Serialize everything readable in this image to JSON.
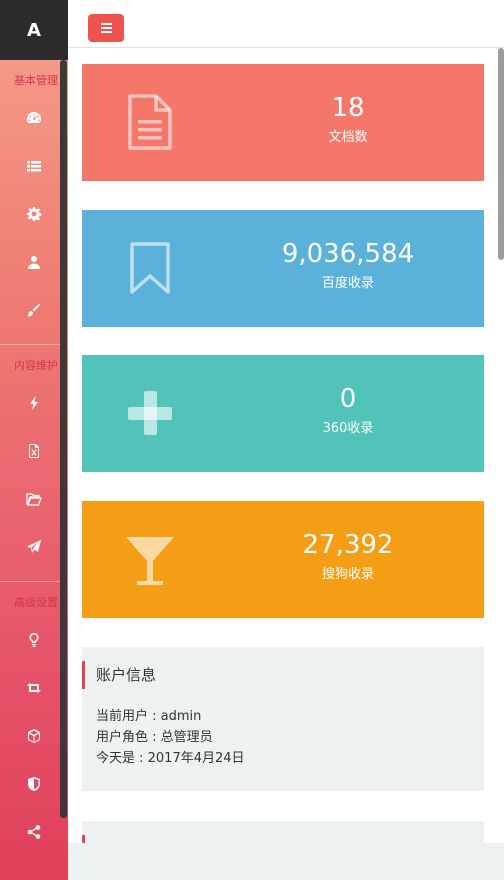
{
  "logo": "A",
  "sidebar": {
    "sections": [
      {
        "title": "基本管理",
        "icons": [
          "dashboard-icon",
          "list-icon",
          "gear-icon",
          "user-icon",
          "brush-icon"
        ]
      },
      {
        "title": "内容维护",
        "icons": [
          "bolt-icon",
          "excel-file-icon",
          "folder-open-icon",
          "paper-plane-icon"
        ]
      },
      {
        "title": "高级设置",
        "icons": [
          "lightbulb-icon",
          "retweet-icon",
          "cube-icon",
          "shield-icon",
          "share-icon"
        ]
      }
    ]
  },
  "stats": [
    {
      "value": "18",
      "label": "文档数",
      "icon": "document-icon",
      "color": "#f5776a"
    },
    {
      "value": "9,036,584",
      "label": "百度收录",
      "icon": "bookmark-icon",
      "color": "#5ab1d9"
    },
    {
      "value": "0",
      "label": "360收录",
      "icon": "plus-icon",
      "color": "#51c3b8"
    },
    {
      "value": "27,392",
      "label": "搜狗收录",
      "icon": "cocktail-glass-icon",
      "color": "#f39e15"
    }
  ],
  "account": {
    "title": "账户信息",
    "current_user": "当前用户 : admin",
    "user_role": "用户角色 : 总管理员",
    "today": "今天是 : 2017年4月24日"
  }
}
